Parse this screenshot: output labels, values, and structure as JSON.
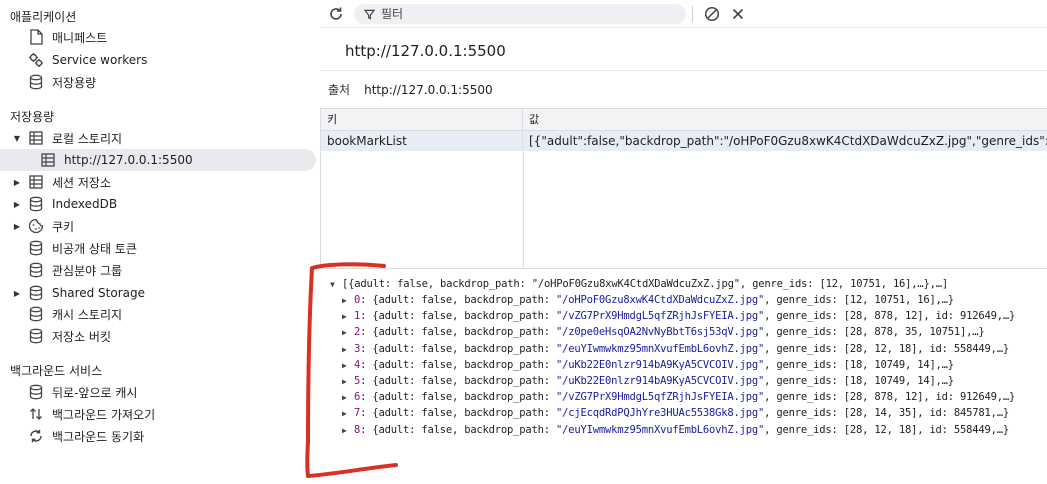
{
  "sidebar": {
    "application_title": "애플리케이션",
    "application_items": [
      {
        "label": "매니페스트",
        "icon": "file-icon"
      },
      {
        "label": "Service workers",
        "icon": "gears-icon"
      },
      {
        "label": "저장용량",
        "icon": "database-icon"
      }
    ],
    "storage_title": "저장용량",
    "local_storage": {
      "label": "로컬 스토리지",
      "child": "http://127.0.0.1:5500"
    },
    "storage_items": [
      {
        "label": "세션 저장소",
        "icon": "grid-icon",
        "expandable": true
      },
      {
        "label": "IndexedDB",
        "icon": "database-icon",
        "expandable": true
      },
      {
        "label": "쿠키",
        "icon": "cookie-icon",
        "expandable": true
      },
      {
        "label": "비공개 상태 토큰",
        "icon": "database-icon",
        "expandable": false
      },
      {
        "label": "관심분야 그룹",
        "icon": "database-icon",
        "expandable": false
      },
      {
        "label": "Shared Storage",
        "icon": "database-icon",
        "expandable": true
      },
      {
        "label": "캐시 스토리지",
        "icon": "database-icon",
        "expandable": false
      },
      {
        "label": "저장소 버킷",
        "icon": "database-icon",
        "expandable": false
      }
    ],
    "background_title": "백그라운드 서비스",
    "background_items": [
      {
        "label": "뒤로-앞으로 캐시",
        "icon": "database-icon"
      },
      {
        "label": "백그라운드 가져오기",
        "icon": "arrows-updown-icon"
      },
      {
        "label": "백그라운드 동기화",
        "icon": "sync-icon"
      }
    ]
  },
  "toolbar": {
    "filter_placeholder": "필터"
  },
  "origin": {
    "title": "http://127.0.0.1:5500",
    "label": "출처",
    "value": "http://127.0.0.1:5500"
  },
  "table": {
    "headers": {
      "key": "키",
      "value": "값"
    },
    "rows": [
      {
        "key": "bookMarkList",
        "value": "[{\"adult\":false,\"backdrop_path\":\"/oHPoF0Gzu8xwK4CtdXDaWdcuZxZ.jpg\",\"genre_ids\":[12,10751,1..."
      }
    ]
  },
  "preview": {
    "root": "[{adult: false, backdrop_path: \"/oHPoF0Gzu8xwK4CtdXDaWdcuZxZ.jpg\", genre_ids: [12, 10751, 16],…},…]",
    "items": [
      {
        "idx": "0",
        "path": "\"/oHPoF0Gzu8xwK4CtdXDaWdcuZxZ.jpg\"",
        "rest": ", genre_ids: [12, 10751, 16],…}"
      },
      {
        "idx": "1",
        "path": "\"/vZG7PrX9HmdgL5qfZRjhJsFYEIA.jpg\"",
        "rest": ", genre_ids: [28, 878, 12], id: 912649,…}"
      },
      {
        "idx": "2",
        "path": "\"/z0pe0eHsqOA2NvNyBbtT6sj53qV.jpg\"",
        "rest": ", genre_ids: [28, 878, 35, 10751],…}"
      },
      {
        "idx": "3",
        "path": "\"/euYIwmwkmz95mnXvufEmbL6ovhZ.jpg\"",
        "rest": ", genre_ids: [28, 12, 18], id: 558449,…}"
      },
      {
        "idx": "4",
        "path": "\"/uKb22E0nlzr914bA9KyA5CVCOIV.jpg\"",
        "rest": ", genre_ids: [18, 10749, 14],…}"
      },
      {
        "idx": "5",
        "path": "\"/uKb22E0nlzr914bA9KyA5CVCOIV.jpg\"",
        "rest": ", genre_ids: [18, 10749, 14],…}"
      },
      {
        "idx": "6",
        "path": "\"/vZG7PrX9HmdgL5qfZRjhJsFYEIA.jpg\"",
        "rest": ", genre_ids: [28, 878, 12], id: 912649,…}"
      },
      {
        "idx": "7",
        "path": "\"/cjEcqdRdPQJhYre3HUAc5538Gk8.jpg\"",
        "rest": ", genre_ids: [28, 14, 35], id: 845781,…}"
      },
      {
        "idx": "8",
        "path": "\"/euYIwmwkmz95mnXvufEmbL6ovhZ.jpg\"",
        "rest": ", genre_ids: [28, 12, 18], id: 558449,…}"
      }
    ],
    "item_prefix": ": {adult: false, backdrop_path: "
  },
  "colors": {
    "accent_index": "#881280",
    "string": "#1a1aa6",
    "annotation": "#d93025",
    "selected_row": "#e8edf5"
  }
}
